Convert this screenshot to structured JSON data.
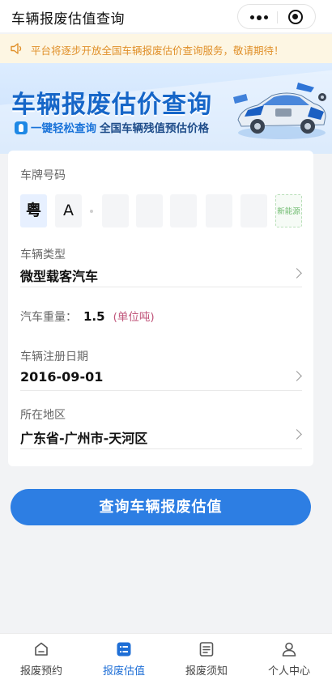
{
  "header": {
    "title": "车辆报废估值查询"
  },
  "notice": {
    "text": "平台将逐步开放全国车辆报废估价查询服务，敬请期待！"
  },
  "banner": {
    "title": "车辆报废估价查询",
    "tagline_highlight": "一键轻松查询",
    "tagline_rest": "全国车辆残值预估价格"
  },
  "form": {
    "plate": {
      "label": "车牌号码",
      "province": "粤",
      "letter": "A",
      "slots": [
        "",
        "",
        "",
        "",
        ""
      ],
      "new_energy": "新能源"
    },
    "vehicle_type": {
      "label": "车辆类型",
      "value": "微型载客汽车"
    },
    "weight": {
      "label": "汽车重量：",
      "value": "1.5",
      "unit": "(单位吨)"
    },
    "reg_date": {
      "label": "车辆注册日期",
      "value": "2016-09-01"
    },
    "region": {
      "label": "所在地区",
      "value": "广东省-广州市-天河区"
    }
  },
  "actions": {
    "query_label": "查询车辆报废估值"
  },
  "tabbar": {
    "active_index": 1,
    "items": [
      {
        "label": "报废预约",
        "icon": "home-icon"
      },
      {
        "label": "报废估值",
        "icon": "list-icon"
      },
      {
        "label": "报废须知",
        "icon": "notice-icon"
      },
      {
        "label": "个人中心",
        "icon": "user-icon"
      }
    ]
  },
  "colors": {
    "primary": "#2d7ee3",
    "notice": "#e0902a",
    "unit": "#c0557a",
    "new_energy": "#6fbb6f"
  }
}
